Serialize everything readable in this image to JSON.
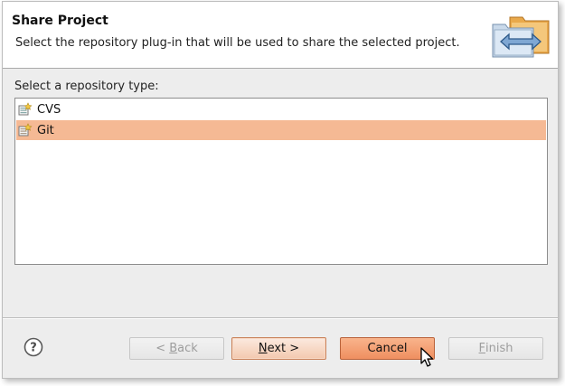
{
  "banner": {
    "title": "Share Project",
    "description": "Select the repository plug-in that will be used to share the selected project."
  },
  "list": {
    "label": "Select a repository type:",
    "items": [
      {
        "label": "CVS",
        "icon": "cvs-repository-icon",
        "selected": false
      },
      {
        "label": "Git",
        "icon": "git-repository-icon",
        "selected": true
      }
    ]
  },
  "buttons": {
    "back": {
      "prefix": "< ",
      "mnemonic": "B",
      "rest": "ack",
      "enabled": false
    },
    "next": {
      "mnemonic": "N",
      "rest": "ext >",
      "enabled": true
    },
    "cancel": {
      "label": "Cancel",
      "enabled": true
    },
    "finish": {
      "mnemonic": "F",
      "rest": "inish",
      "enabled": false
    }
  },
  "colors": {
    "selection": "#f5b994",
    "cancel_hover": "#ef8f60"
  }
}
